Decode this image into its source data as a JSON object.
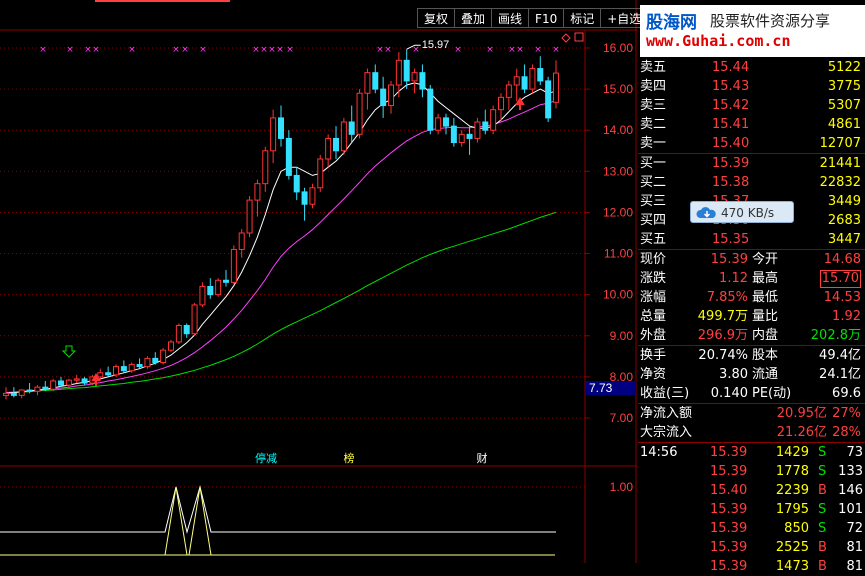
{
  "toolbar": [
    "复权",
    "叠加",
    "画线",
    "F10",
    "标记",
    "+自选"
  ],
  "logo": {
    "cn_brand": "股海网",
    "cn_slogan": "股票软件资源分享",
    "url": "www.Guhai.com.cn"
  },
  "chart_data": {
    "type": "candlestick",
    "price_axis_ticks": [
      "16.00",
      "15.00",
      "14.00",
      "13.00",
      "12.00",
      "11.00",
      "10.00",
      "9.00",
      "8.00",
      "7.00"
    ],
    "price_range": [
      7.0,
      16.0
    ],
    "peak_annotation": "15.97",
    "current_price_marker": "7.73",
    "indicator_axis_tick": "1.00",
    "event_labels": [
      "停减",
      "榜",
      "财"
    ],
    "candles": [
      [
        7.55,
        7.75,
        7.45,
        7.6
      ],
      [
        7.6,
        7.75,
        7.5,
        7.55
      ],
      [
        7.55,
        7.7,
        7.48,
        7.68
      ],
      [
        7.68,
        7.85,
        7.6,
        7.65
      ],
      [
        7.65,
        7.8,
        7.55,
        7.75
      ],
      [
        7.75,
        7.9,
        7.65,
        7.7
      ],
      [
        7.7,
        7.95,
        7.65,
        7.9
      ],
      [
        7.9,
        8.0,
        7.75,
        7.8
      ],
      [
        7.8,
        7.95,
        7.72,
        7.92
      ],
      [
        7.92,
        8.05,
        7.85,
        7.95
      ],
      [
        7.95,
        8.0,
        7.8,
        7.85
      ],
      [
        7.85,
        8.05,
        7.8,
        8.0
      ],
      [
        8.0,
        8.2,
        7.95,
        8.1
      ],
      [
        8.1,
        8.25,
        8.0,
        8.05
      ],
      [
        8.05,
        8.3,
        8.0,
        8.25
      ],
      [
        8.25,
        8.4,
        8.1,
        8.15
      ],
      [
        8.15,
        8.35,
        8.1,
        8.3
      ],
      [
        8.3,
        8.45,
        8.2,
        8.25
      ],
      [
        8.25,
        8.5,
        8.2,
        8.45
      ],
      [
        8.45,
        8.6,
        8.3,
        8.35
      ],
      [
        8.35,
        8.7,
        8.3,
        8.65
      ],
      [
        8.65,
        8.9,
        8.6,
        8.85
      ],
      [
        8.85,
        9.3,
        8.8,
        9.25
      ],
      [
        9.25,
        9.3,
        8.95,
        9.05
      ],
      [
        9.05,
        9.8,
        9.0,
        9.75
      ],
      [
        9.75,
        10.3,
        9.7,
        10.2
      ],
      [
        10.2,
        10.4,
        9.9,
        10.0
      ],
      [
        10.0,
        10.4,
        9.95,
        10.35
      ],
      [
        10.35,
        10.6,
        10.2,
        10.3
      ],
      [
        10.3,
        11.2,
        10.25,
        11.1
      ],
      [
        11.1,
        11.6,
        10.9,
        11.5
      ],
      [
        11.5,
        12.4,
        11.4,
        12.3
      ],
      [
        12.3,
        12.8,
        11.9,
        12.7
      ],
      [
        12.7,
        13.6,
        12.5,
        13.5
      ],
      [
        13.5,
        14.5,
        13.2,
        14.3
      ],
      [
        14.3,
        14.6,
        13.6,
        13.8
      ],
      [
        13.8,
        14.0,
        12.8,
        12.9
      ],
      [
        12.9,
        13.1,
        12.3,
        12.5
      ],
      [
        12.5,
        12.6,
        11.8,
        12.2
      ],
      [
        12.2,
        12.7,
        12.1,
        12.6
      ],
      [
        12.6,
        13.4,
        12.5,
        13.3
      ],
      [
        13.3,
        13.9,
        13.1,
        13.8
      ],
      [
        13.8,
        14.1,
        13.3,
        13.5
      ],
      [
        13.5,
        14.3,
        13.4,
        14.2
      ],
      [
        14.2,
        14.6,
        13.7,
        13.9
      ],
      [
        13.9,
        15.0,
        13.8,
        14.9
      ],
      [
        14.9,
        15.5,
        14.5,
        15.4
      ],
      [
        15.4,
        15.6,
        14.9,
        15.0
      ],
      [
        15.0,
        15.3,
        14.3,
        14.6
      ],
      [
        14.6,
        15.2,
        14.4,
        15.1
      ],
      [
        15.1,
        15.9,
        14.8,
        15.7
      ],
      [
        15.7,
        15.97,
        15.0,
        15.2
      ],
      [
        15.2,
        15.5,
        14.9,
        15.4
      ],
      [
        15.4,
        15.6,
        14.8,
        15.0
      ],
      [
        15.0,
        15.1,
        13.9,
        14.0
      ],
      [
        14.0,
        14.4,
        13.9,
        14.3
      ],
      [
        14.3,
        14.4,
        13.9,
        14.1
      ],
      [
        14.1,
        14.3,
        13.6,
        13.7
      ],
      [
        13.7,
        14.0,
        13.6,
        13.9
      ],
      [
        13.9,
        14.1,
        13.4,
        13.8
      ],
      [
        13.8,
        14.3,
        13.7,
        14.2
      ],
      [
        14.2,
        14.5,
        13.9,
        14.0
      ],
      [
        14.0,
        14.6,
        13.9,
        14.5
      ],
      [
        14.5,
        14.9,
        14.2,
        14.8
      ],
      [
        14.8,
        15.2,
        14.5,
        15.1
      ],
      [
        15.1,
        15.5,
        14.7,
        15.3
      ],
      [
        15.3,
        15.6,
        14.9,
        15.0
      ],
      [
        15.0,
        15.6,
        14.9,
        15.5
      ],
      [
        15.5,
        15.8,
        15.1,
        15.2
      ],
      [
        15.2,
        15.3,
        14.2,
        14.3
      ],
      [
        14.68,
        15.7,
        14.53,
        15.39
      ]
    ],
    "ma_long": [
      7.6,
      7.62,
      7.63,
      7.64,
      7.66,
      7.67,
      7.68,
      7.7,
      7.71,
      7.73,
      7.74,
      7.76,
      7.78,
      7.8,
      7.82,
      7.84,
      7.87,
      7.89,
      7.92,
      7.95,
      7.98,
      8.02,
      8.06,
      8.11,
      8.16,
      8.22,
      8.28,
      8.35,
      8.42,
      8.5,
      8.59,
      8.69,
      8.8,
      8.92,
      9.04,
      9.15,
      9.25,
      9.34,
      9.43,
      9.52,
      9.61,
      9.71,
      9.81,
      9.91,
      10.01,
      10.11,
      10.22,
      10.32,
      10.42,
      10.52,
      10.62,
      10.72,
      10.81,
      10.9,
      10.98,
      11.05,
      11.12,
      11.18,
      11.24,
      11.3,
      11.36,
      11.42,
      11.48,
      11.54,
      11.6,
      11.67,
      11.74,
      11.81,
      11.88,
      11.94,
      12.0
    ],
    "ma_mid": [
      7.62,
      7.63,
      7.64,
      7.66,
      7.67,
      7.69,
      7.71,
      7.73,
      7.75,
      7.78,
      7.8,
      7.83,
      7.86,
      7.9,
      7.93,
      7.97,
      8.01,
      8.05,
      8.1,
      8.15,
      8.21,
      8.28,
      8.37,
      8.47,
      8.59,
      8.73,
      8.88,
      9.04,
      9.21,
      9.41,
      9.62,
      9.86,
      10.1,
      10.37,
      10.67,
      10.93,
      11.13,
      11.29,
      11.43,
      11.58,
      11.76,
      11.95,
      12.14,
      12.33,
      12.53,
      12.73,
      12.94,
      13.13,
      13.29,
      13.45,
      13.6,
      13.74,
      13.85,
      13.95,
      14.01,
      14.04,
      14.06,
      14.07,
      14.06,
      14.06,
      14.08,
      14.1,
      14.14,
      14.2,
      14.27,
      14.36,
      14.44,
      14.53,
      14.62,
      14.66,
      14.72
    ],
    "ma_short": [
      7.6,
      7.62,
      7.64,
      7.66,
      7.68,
      7.7,
      7.73,
      7.77,
      7.8,
      7.84,
      7.87,
      7.91,
      7.95,
      8.0,
      8.05,
      8.1,
      8.15,
      8.2,
      8.27,
      8.33,
      8.42,
      8.53,
      8.68,
      8.83,
      9.02,
      9.28,
      9.5,
      9.73,
      9.95,
      10.22,
      10.55,
      10.95,
      11.4,
      11.95,
      12.55,
      13.0,
      13.1,
      13.1,
      13.0,
      12.9,
      12.95,
      13.1,
      13.25,
      13.45,
      13.7,
      13.95,
      14.25,
      14.5,
      14.65,
      14.75,
      14.95,
      15.1,
      15.15,
      15.1,
      14.9,
      14.7,
      14.55,
      14.4,
      14.25,
      14.1,
      14.05,
      14.05,
      14.1,
      14.25,
      14.45,
      14.65,
      14.8,
      14.9,
      15.0,
      14.9,
      14.95
    ],
    "indicator": [
      0,
      0,
      0,
      0,
      0,
      0,
      0,
      0,
      0,
      0,
      0,
      0,
      0,
      0,
      0,
      0,
      0,
      0,
      0,
      0,
      0,
      0,
      0,
      0,
      0,
      0,
      0,
      0,
      0,
      0,
      0,
      0,
      0,
      0,
      0,
      0,
      0,
      0,
      0,
      0,
      0,
      0,
      0,
      0,
      0,
      0,
      0,
      0,
      0,
      0,
      0,
      0,
      0,
      0,
      0,
      0,
      0,
      0,
      0,
      0,
      0,
      0,
      0,
      0,
      0,
      0,
      0,
      0,
      0,
      0,
      0
    ]
  },
  "quote": {
    "asks": [
      {
        "label": "卖五",
        "price": "15.44",
        "vol": "5122"
      },
      {
        "label": "卖四",
        "price": "15.43",
        "vol": "3775"
      },
      {
        "label": "卖三",
        "price": "15.42",
        "vol": "5307"
      },
      {
        "label": "卖二",
        "price": "15.41",
        "vol": "4861"
      },
      {
        "label": "卖一",
        "price": "15.40",
        "vol": "12707"
      }
    ],
    "bids": [
      {
        "label": "买一",
        "price": "15.39",
        "vol": "21441"
      },
      {
        "label": "买二",
        "price": "15.38",
        "vol": "22832"
      },
      {
        "label": "买三",
        "price": "15.37",
        "vol": "3449"
      },
      {
        "label": "买四",
        "price": "15.36",
        "vol": "2683"
      },
      {
        "label": "买五",
        "price": "15.35",
        "vol": "3447"
      }
    ],
    "stats": [
      {
        "l1": "现价",
        "v1": "15.39",
        "l2": "今开",
        "v2": "14.68"
      },
      {
        "l1": "涨跌",
        "v1": "1.12",
        "l2": "最高",
        "v2": "15.70"
      },
      {
        "l1": "涨幅",
        "v1": "7.85%",
        "l2": "最低",
        "v2": "14.53"
      },
      {
        "l1": "总量",
        "v1": "499.7万",
        "l2": "量比",
        "v2": "1.92"
      },
      {
        "l1": "外盘",
        "v1": "296.9万",
        "l2": "内盘",
        "v2": "202.8万"
      }
    ],
    "fund": [
      {
        "l1": "换手",
        "v1": "20.74%",
        "l2": "股本",
        "v2": "49.4亿"
      },
      {
        "l1": "净资",
        "v1": "3.80",
        "l2": "流通",
        "v2": "24.1亿"
      },
      {
        "l1": "收益(三)",
        "v1": "0.140",
        "l2": "PE(动)",
        "v2": "69.6"
      }
    ],
    "flow": [
      {
        "label": "净流入额",
        "value": "20.95亿",
        "pct": "27%"
      },
      {
        "label": "大宗流入",
        "value": "21.26亿",
        "pct": "28%"
      }
    ],
    "ticks": [
      {
        "time": "14:56",
        "price": "15.39",
        "vol": "1429",
        "side": "S",
        "num": "73"
      },
      {
        "time": "",
        "price": "15.39",
        "vol": "1778",
        "side": "S",
        "num": "133"
      },
      {
        "time": "",
        "price": "15.40",
        "vol": "2239",
        "side": "B",
        "num": "146"
      },
      {
        "time": "",
        "price": "15.39",
        "vol": "1795",
        "side": "S",
        "num": "101"
      },
      {
        "time": "",
        "price": "15.39",
        "vol": "850",
        "side": "S",
        "num": "72"
      },
      {
        "time": "",
        "price": "15.39",
        "vol": "2525",
        "side": "B",
        "num": "81"
      },
      {
        "time": "",
        "price": "15.39",
        "vol": "1473",
        "side": "B",
        "num": "81"
      }
    ]
  },
  "speed": {
    "value": "470 KB/s"
  },
  "colors": {
    "up": "#ff3333",
    "down": "#33e0ff",
    "ma_short": "#ffffff",
    "ma_mid": "#ff40ff",
    "ma_long": "#00dd00",
    "grid": "#8b0000"
  }
}
